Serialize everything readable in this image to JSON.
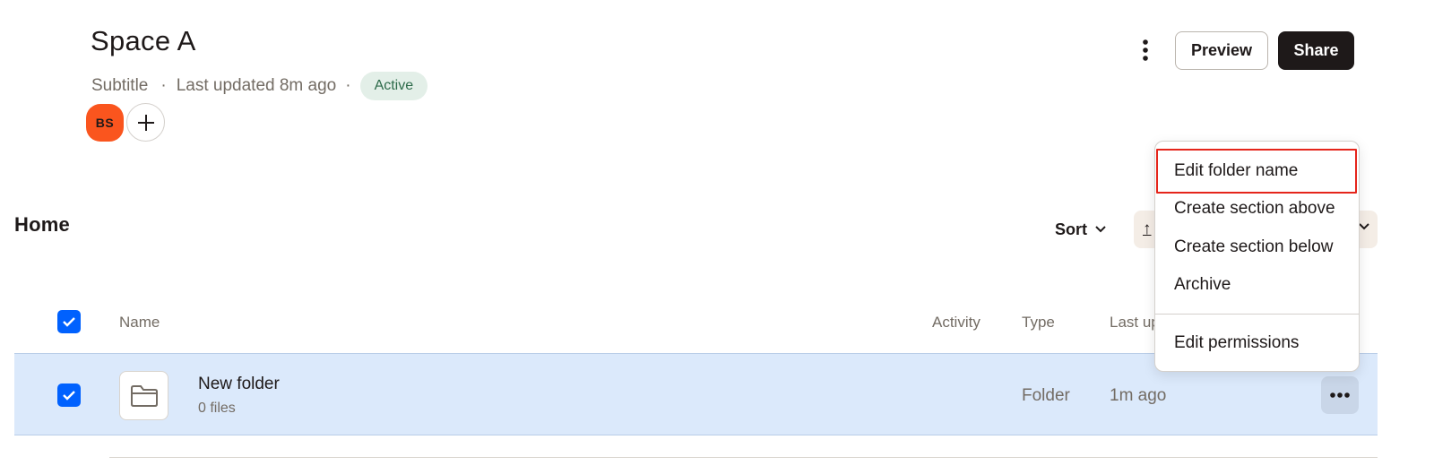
{
  "header": {
    "title": "Space A",
    "subtitle": "Subtitle",
    "separator": "·",
    "last_updated": "Last updated 8m ago",
    "status": "Active",
    "avatar_initials": "BS",
    "preview_label": "Preview",
    "share_label": "Share"
  },
  "section": {
    "title": "Home",
    "sort_label": "Sort",
    "upload_glyph": "↑"
  },
  "table": {
    "columns": [
      "Name",
      "Activity",
      "Type",
      "Last up"
    ],
    "rows": [
      {
        "name": "New folder",
        "detail": "0 files",
        "type": "Folder",
        "updated": "1m ago"
      }
    ]
  },
  "menu": {
    "items": [
      "Edit folder name",
      "Create section above",
      "Create section below",
      "Archive",
      "Edit permissions"
    ]
  },
  "colors": {
    "accent_blue": "#0061fe",
    "avatar_orange": "#fa551e",
    "row_selected": "#dbe9fb",
    "highlight_red": "#e5251b"
  }
}
